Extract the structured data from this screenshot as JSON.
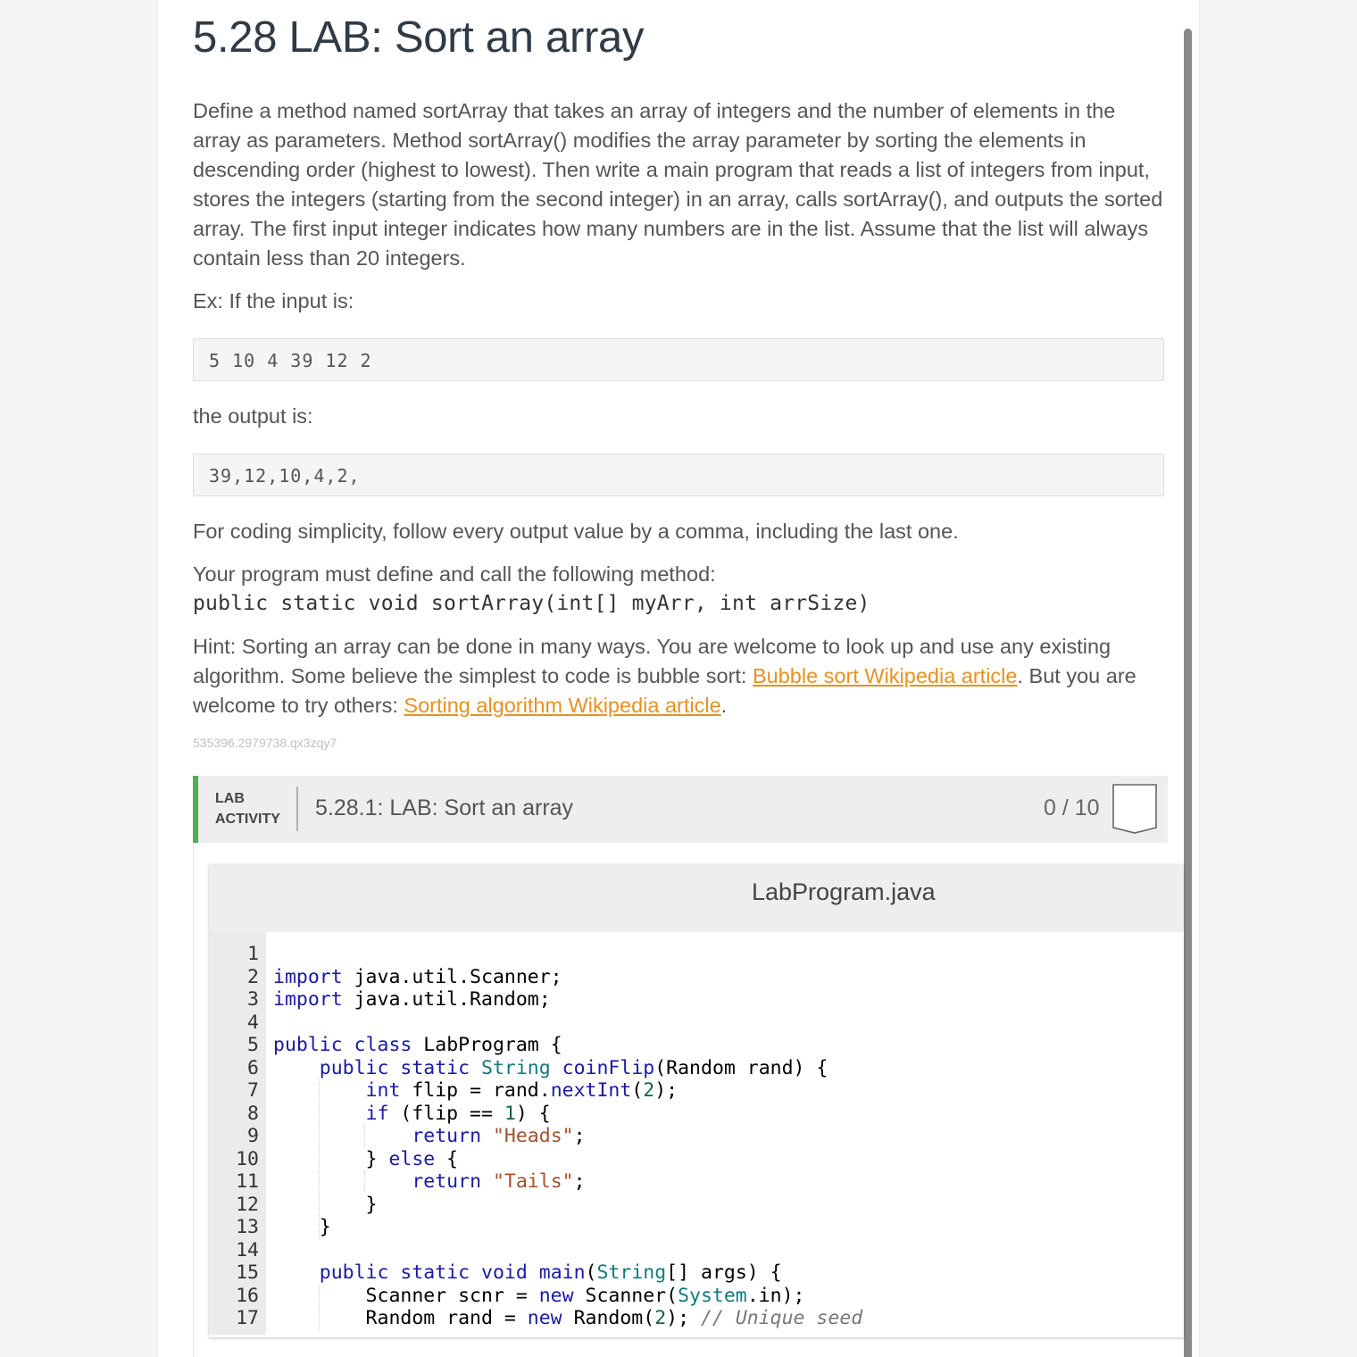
{
  "page": {
    "title": "5.28 LAB: Sort an array",
    "description": "Define a method named sortArray that takes an array of integers and the number of elements in the array as parameters. Method sortArray() modifies the array parameter by sorting the elements in descending order (highest to lowest). Then write a main program that reads a list of integers from input, stores the integers (starting from the second integer) in an array, calls sortArray(), and outputs the sorted array. The first input integer indicates how many numbers are in the list. Assume that the list will always contain less than 20 integers.",
    "example_input_label": "Ex: If the input is:",
    "example_input": "5 10 4 39 12 2",
    "example_output_label": "the output is:",
    "example_output": "39,12,10,4,2,",
    "simplicity_note": "For coding simplicity, follow every output value by a comma, including the last one.",
    "must_define": "Your program must define and call the following method:",
    "method_signature": "public static void sortArray(int[] myArr, int arrSize)",
    "hint_prefix": "Hint: Sorting an array can be done in many ways. You are welcome to look up and use any existing algorithm. Some believe the simplest to code is bubble sort: ",
    "hint_link1": "Bubble sort Wikipedia article",
    "hint_middle": ". But you are welcome to try others: ",
    "hint_link2": "Sorting algorithm Wikipedia article",
    "hint_suffix": ".",
    "hash_id": "535396.2979738.qx3zqy7"
  },
  "lab": {
    "tag_line1": "LAB",
    "tag_line2": "ACTIVITY",
    "name": "5.28.1: LAB: Sort an array",
    "score": "0 / 10",
    "accent_color": "#4caf50"
  },
  "editor": {
    "filename": "LabProgram.java",
    "line_numbers": [
      "1",
      "2",
      "3",
      "4",
      "5",
      "6",
      "7",
      "8",
      "9",
      "10",
      "11",
      "12",
      "13",
      "14",
      "15",
      "16",
      "17"
    ],
    "lines": [
      "",
      "import java.util.Scanner;",
      "import java.util.Random;",
      "",
      "public class LabProgram {",
      "    public static String coinFlip(Random rand) {",
      "        int flip = rand.nextInt(2);",
      "        if (flip == 1) {",
      "            return \"Heads\";",
      "        } else {",
      "            return \"Tails\";",
      "        }",
      "    }",
      "",
      "    public static void main(String[] args) {",
      "        Scanner scnr = new Scanner(System.in);",
      "        Random rand = new Random(2); // Unique seed"
    ]
  }
}
